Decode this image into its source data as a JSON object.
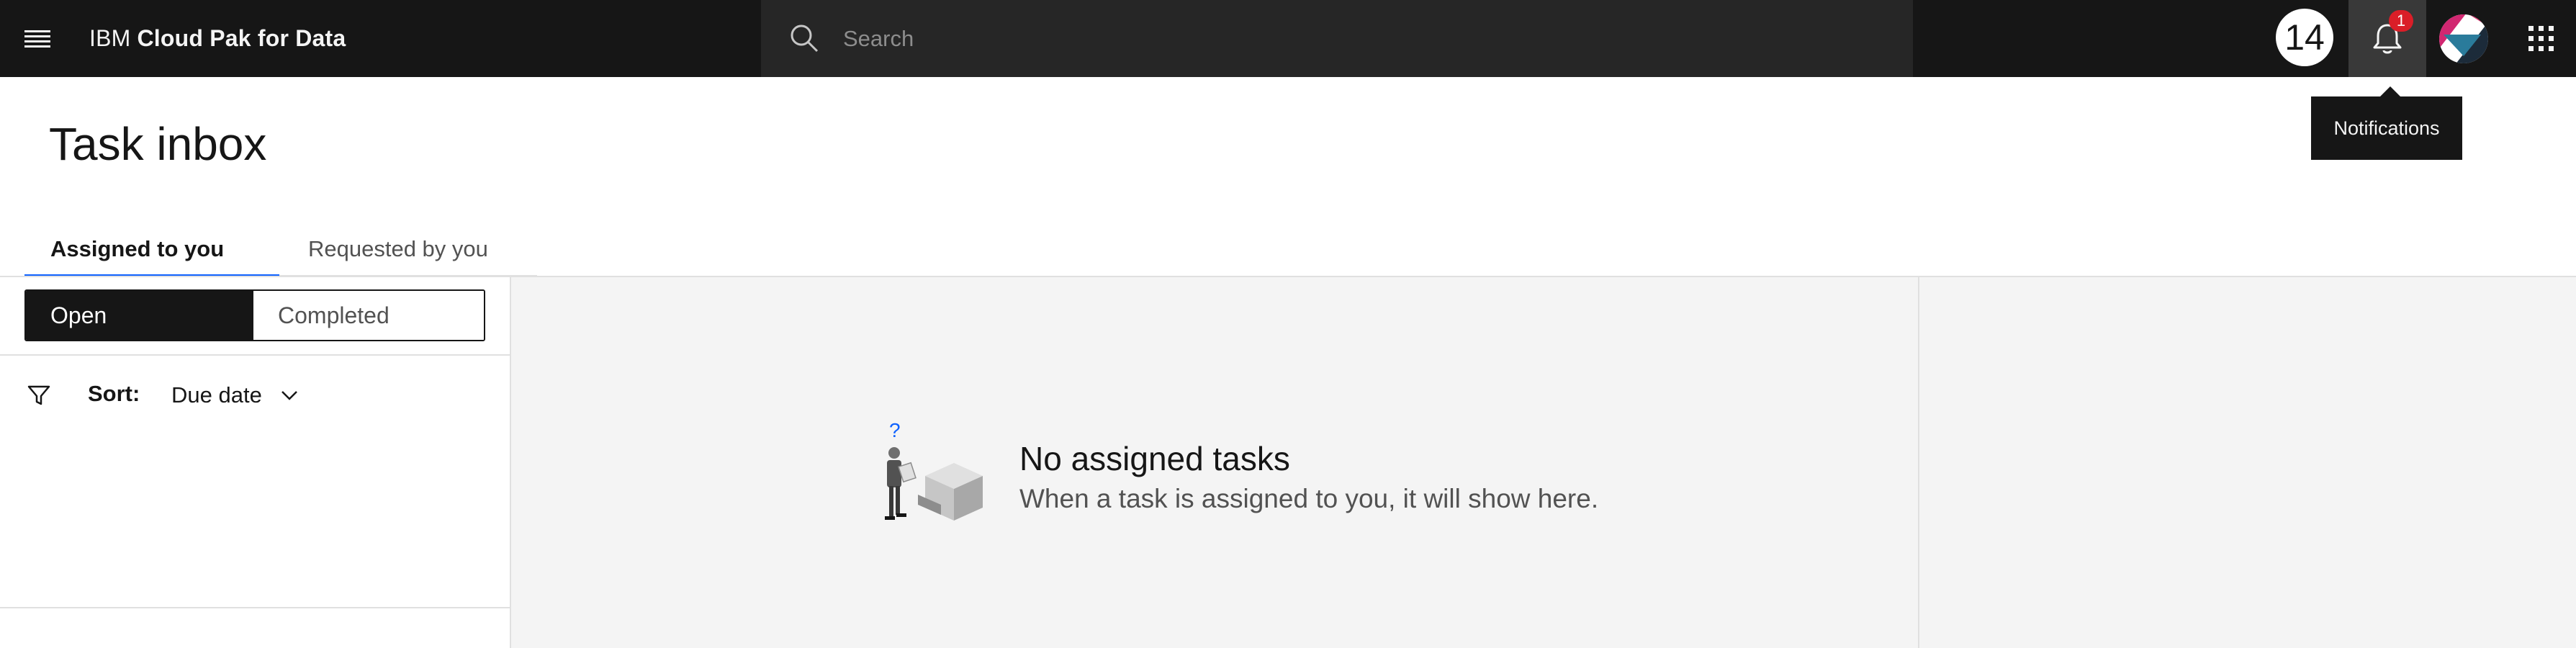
{
  "header": {
    "brand_prefix": "IBM",
    "brand_name": "Cloud Pak for Data",
    "search_placeholder": "Search",
    "badge_count": "14",
    "notification_count": "1",
    "tooltip": "Notifications"
  },
  "page": {
    "title": "Task inbox"
  },
  "tabs": [
    {
      "label": "Assigned to you",
      "active": true
    },
    {
      "label": "Requested by you",
      "active": false
    }
  ],
  "filter": {
    "open_label": "Open",
    "completed_label": "Completed",
    "sort_label": "Sort:",
    "sort_value": "Due date"
  },
  "empty_state": {
    "title": "No assigned tasks",
    "subtitle": "When a task is assigned to you, it will show here.",
    "illustration_mark": "?"
  },
  "icons": {
    "menu": "hamburger-menu-icon",
    "search": "search-icon",
    "notification": "bell-icon",
    "avatar": "user-avatar-icon",
    "switcher": "app-switcher-grid-icon",
    "filter": "filter-funnel-icon",
    "sort_dropdown": "chevron-down-icon"
  },
  "colors": {
    "header_bg": "#161616",
    "search_bg": "#262626",
    "active_tab_accent": "#0f62fe",
    "notification_badge": "#da1e28",
    "empty_bg": "#f4f4f4"
  }
}
